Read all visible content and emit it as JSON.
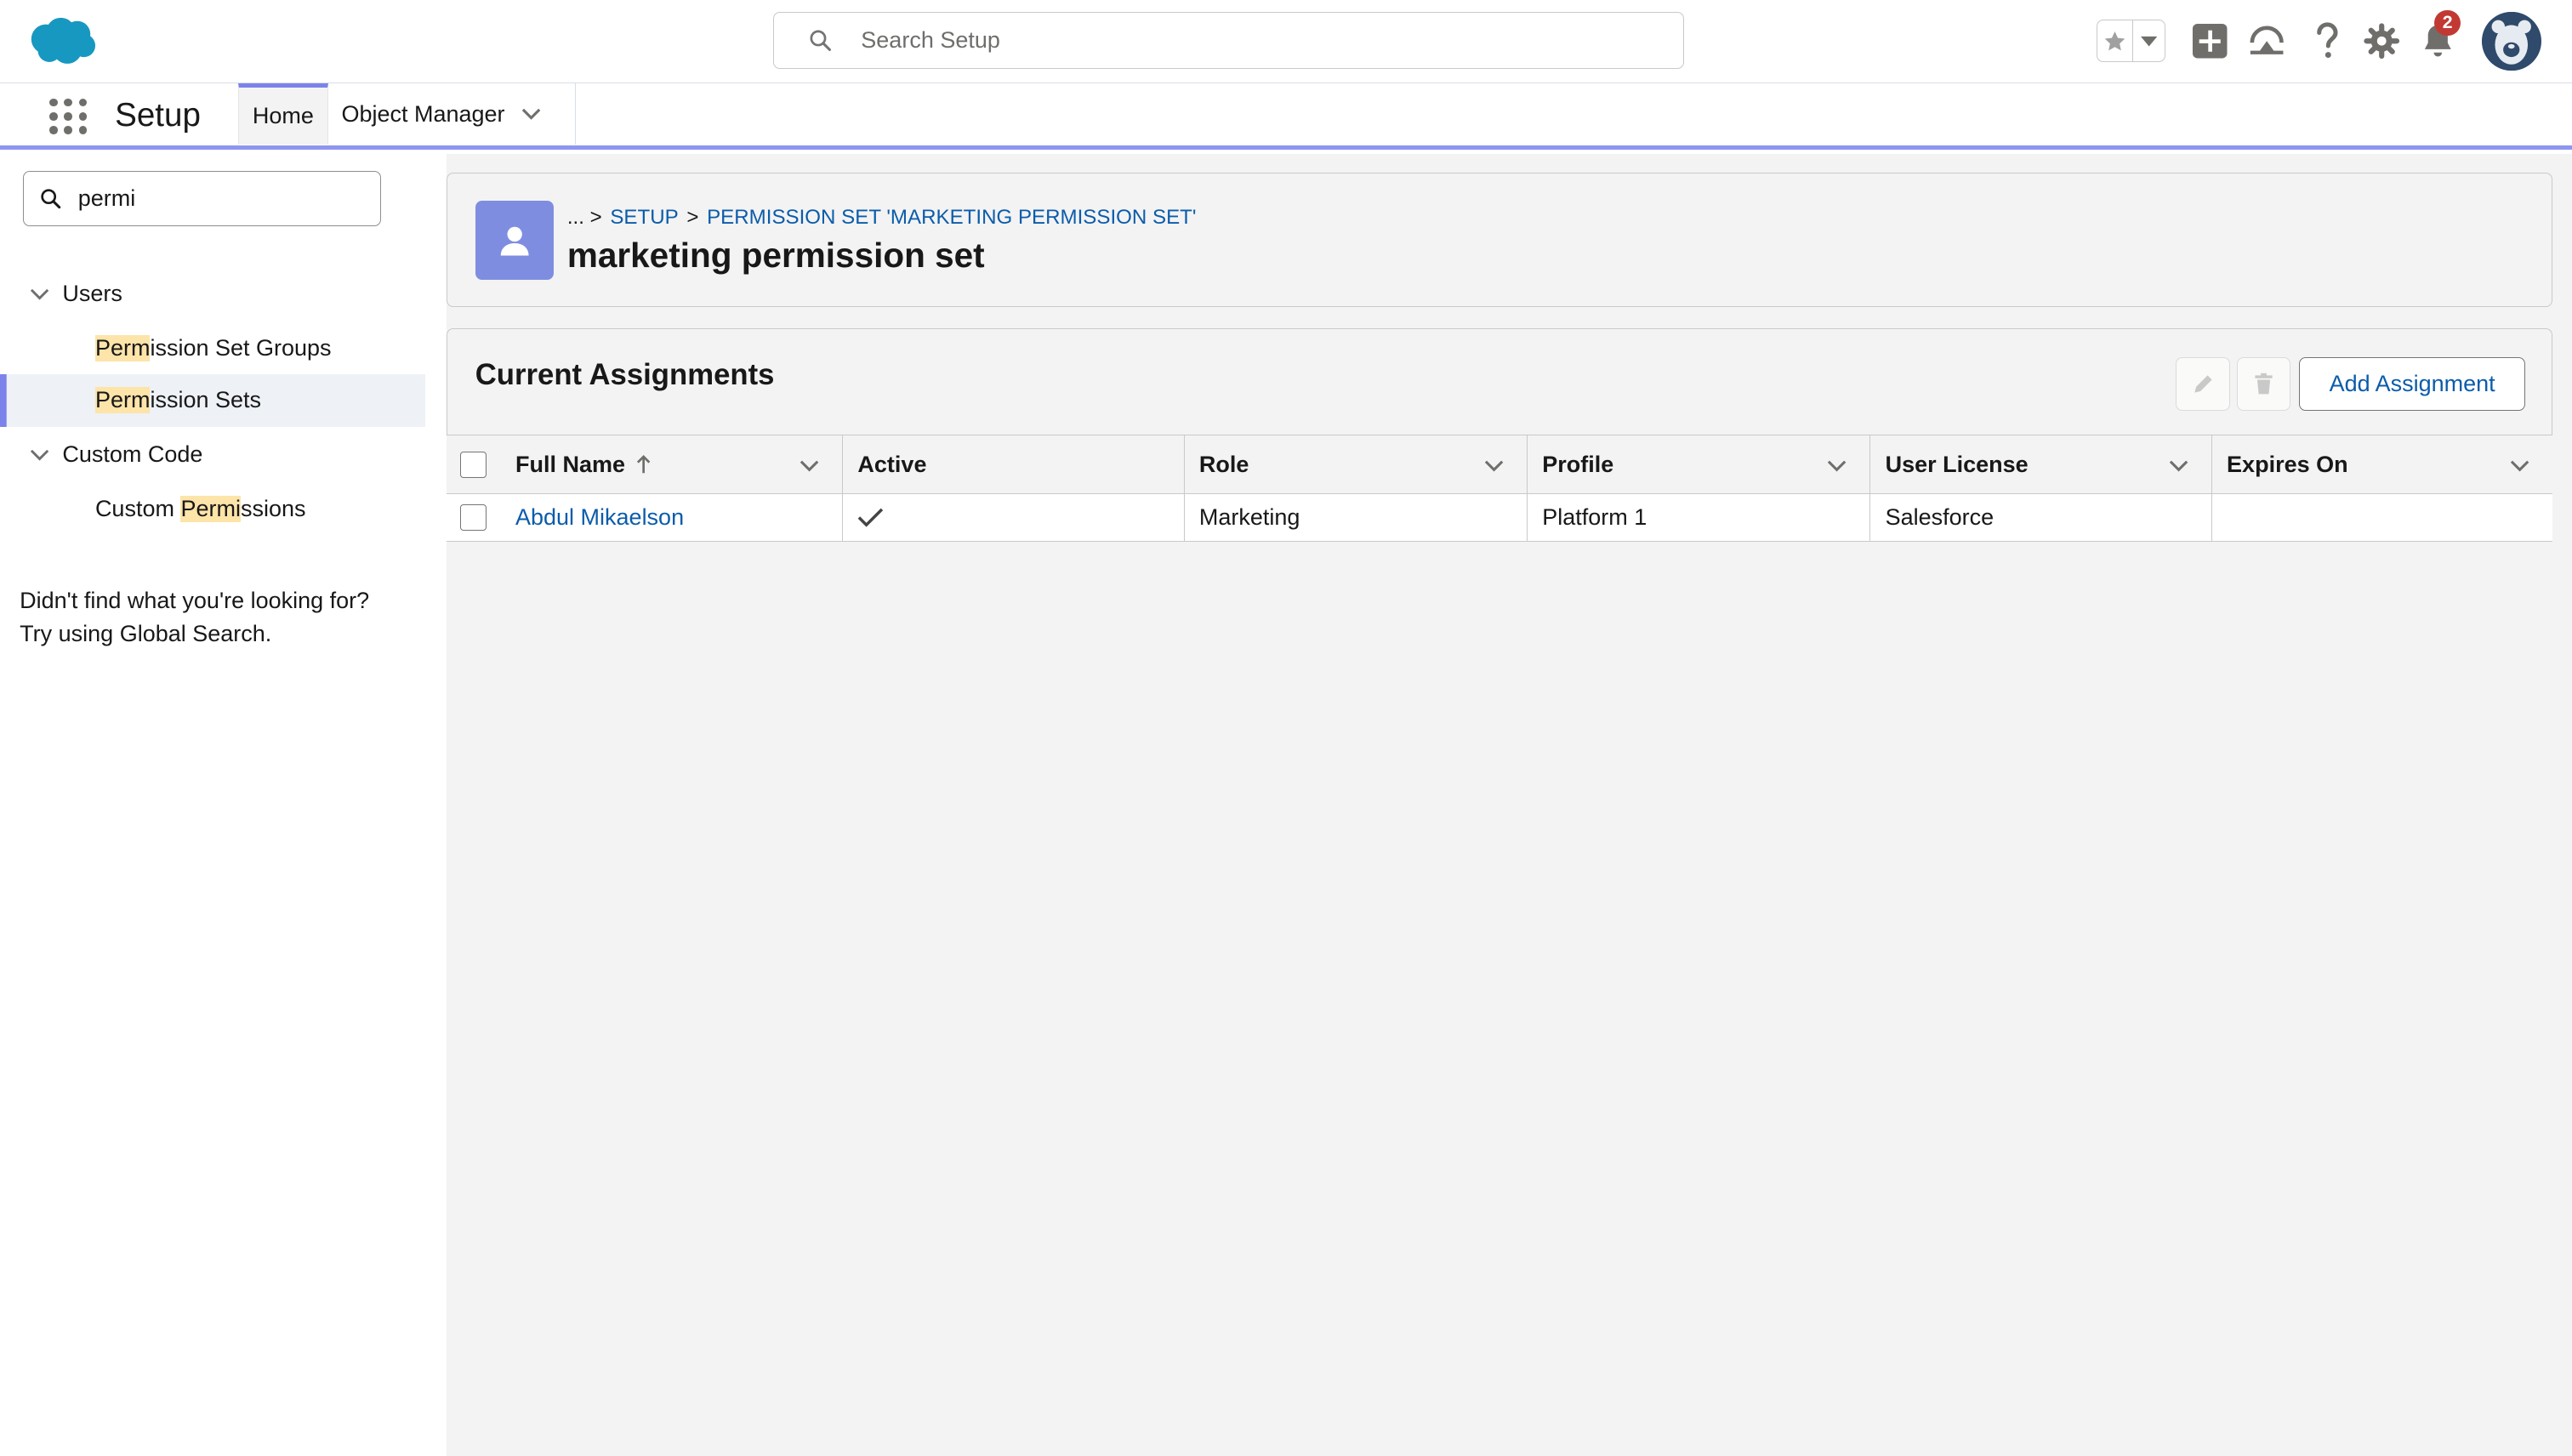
{
  "header": {
    "search_placeholder": "Search Setup",
    "notification_count": "2",
    "brand_color": "#1798c1"
  },
  "nav": {
    "app_name": "Setup",
    "tabs": [
      {
        "label": "Home",
        "active": true
      },
      {
        "label": "Object Manager",
        "active": false
      }
    ]
  },
  "sidebar": {
    "quickfind_value": "permi",
    "tree": [
      {
        "type": "section",
        "label": "Users",
        "expanded": true
      },
      {
        "type": "leaf",
        "label_hl": "Perm",
        "label_rest": "ission Set Groups",
        "selected": false
      },
      {
        "type": "leaf",
        "label_hl": "Perm",
        "label_rest": "ission Sets",
        "selected": true
      },
      {
        "type": "section",
        "label": "Custom Code",
        "expanded": true
      },
      {
        "type": "leaf",
        "label_pre": "Custom ",
        "label_hl": "Permi",
        "label_rest": "ssions",
        "selected": false
      }
    ],
    "hint_line1": "Didn't find what you're looking for?",
    "hint_line2": "Try using Global Search."
  },
  "page_header": {
    "breadcrumb": {
      "ellipsis": "... >",
      "setup": "SETUP",
      "sep": ">",
      "current": "PERMISSION SET 'MARKETING PERMISSION SET'"
    },
    "title": "marketing permission set"
  },
  "assignments": {
    "title": "Current Assignments",
    "add_label": "Add Assignment",
    "columns": [
      "Full Name",
      "Active",
      "Role",
      "Profile",
      "User License",
      "Expires On"
    ],
    "sort_column": "Full Name",
    "rows": [
      {
        "full_name": "Abdul Mikaelson",
        "active": true,
        "role": "Marketing",
        "profile": "Platform 1",
        "user_license": "Salesforce",
        "expires_on": ""
      }
    ]
  }
}
